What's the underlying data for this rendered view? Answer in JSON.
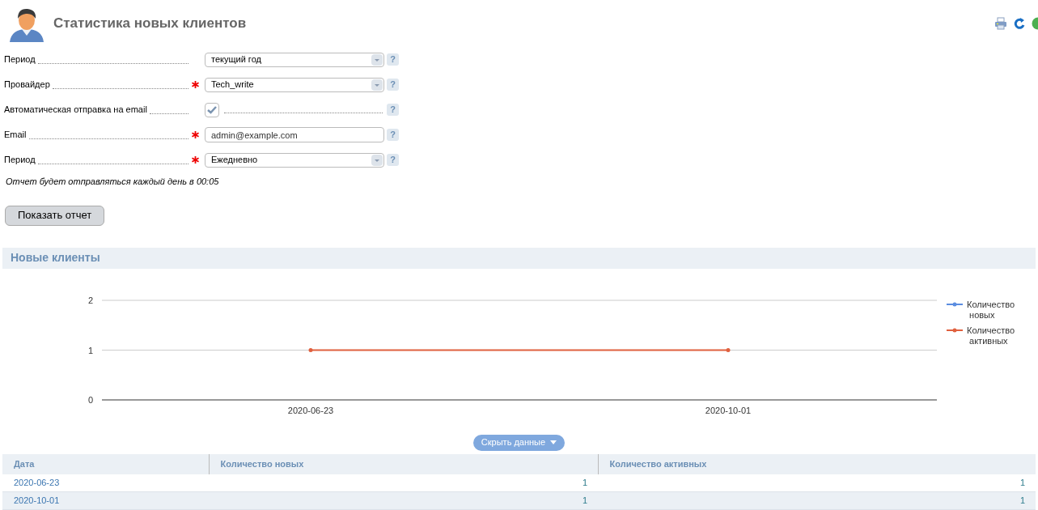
{
  "page": {
    "title": "Статистика новых клиентов"
  },
  "toolbar": [
    {
      "kind": "print"
    },
    {
      "kind": "refresh"
    },
    {
      "kind": "globe"
    }
  ],
  "form": {
    "fields": [
      {
        "kind": "select",
        "label": "Период",
        "required": false,
        "value": "текущий год",
        "help": "?"
      },
      {
        "kind": "select",
        "label": "Провайдер",
        "required": true,
        "value": "Tech_write",
        "help": "?"
      },
      {
        "kind": "checkbox",
        "label": "Автоматическая отправка на email",
        "required": false,
        "checked": true,
        "help": "?"
      },
      {
        "kind": "text",
        "label": "Email",
        "required": true,
        "value": "admin@example.com",
        "help": "?"
      },
      {
        "kind": "select",
        "label": "Период",
        "required": true,
        "value": "Ежедневно",
        "help": "?"
      }
    ],
    "note": "Отчет будет отправляться каждый день в 00:05",
    "submit": "Показать отчет"
  },
  "section": {
    "title": "Новые клиенты",
    "chart_data": {
      "type": "line",
      "categories": [
        "2020-06-23",
        "2020-10-01"
      ],
      "yticks": [
        0,
        1,
        2
      ],
      "ylim": [
        0,
        2
      ],
      "series": [
        {
          "name": "Количество новых",
          "color": "#5b8de0",
          "values": [
            null,
            null
          ]
        },
        {
          "name": "Количество активных",
          "color": "#e0603e",
          "values": [
            1,
            1
          ]
        }
      ]
    },
    "toggle": "Скрыть данные",
    "table": {
      "columns": [
        "Дата",
        "Количество новых",
        "Количество активных"
      ],
      "rows": [
        [
          "2020-06-23",
          "1",
          "1"
        ],
        [
          "2020-10-01",
          "1",
          "1"
        ]
      ]
    }
  }
}
